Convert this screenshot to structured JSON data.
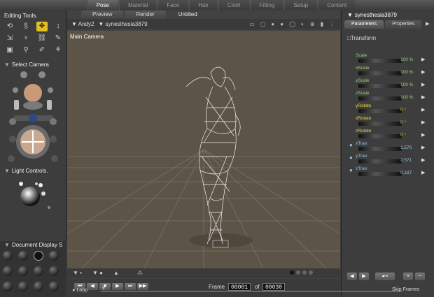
{
  "rooms": [
    "Pose",
    "Material",
    "Face",
    "Hair",
    "Cloth",
    "Fitting",
    "Setup",
    "Content"
  ],
  "left": {
    "editing_tools_title": "Editing Tools.",
    "select_camera_title": "Select Camera",
    "light_controls_title": "Light Controls.",
    "document_display_title": "Document Display S"
  },
  "center": {
    "tabs": [
      "Preview",
      "Render"
    ],
    "doc_title": "Untitled",
    "figure_menu": "Andy2",
    "actor_menu": "synesthesia3879",
    "camera_label": "Main Camera",
    "frame_label": "Frame",
    "frame_current": "00001",
    "frame_of": "of",
    "frame_total": "00030",
    "loop_label": "Loop",
    "skip_frames_label": "Skip Frames"
  },
  "right": {
    "title": "synesthesia3879",
    "tabs": [
      "Parameters",
      "Properties"
    ],
    "group": "Transform",
    "params": [
      {
        "name": "Scale",
        "value": "100 %",
        "color": "#9fd07a"
      },
      {
        "name": "xScale",
        "value": "100 %",
        "color": "#9fd07a"
      },
      {
        "name": "yScale",
        "value": "100 %",
        "color": "#9fd07a"
      },
      {
        "name": "zScale",
        "value": "100 %",
        "color": "#9fd07a"
      },
      {
        "name": "yRotate",
        "value": "0 °",
        "color": "#e8d24a"
      },
      {
        "name": "xRotate",
        "value": "0 °",
        "color": "#e8d24a"
      },
      {
        "name": "zRotate",
        "value": "0 °",
        "color": "#e8d24a"
      },
      {
        "name": "xTran",
        "value": "1.570",
        "color": "#8ec8e8"
      },
      {
        "name": "yTran",
        "value": "2.571",
        "color": "#8ec8e8"
      },
      {
        "name": "zTran",
        "value": "0.187",
        "color": "#8ec8e8"
      }
    ]
  }
}
